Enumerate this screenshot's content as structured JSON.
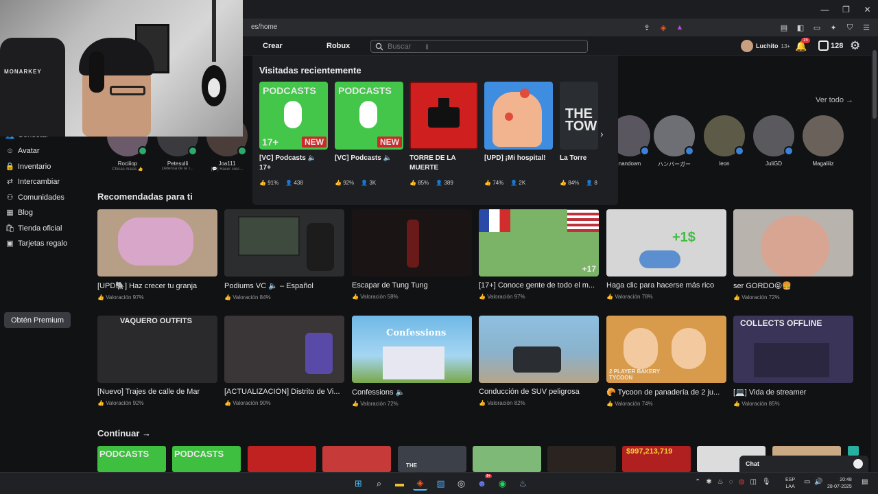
{
  "browser": {
    "url": "es/home",
    "window_minimize": "—",
    "window_restore": "❐",
    "window_close": "✕"
  },
  "nav": {
    "create": "Crear",
    "robux": "Robux",
    "search_placeholder": "Buscar",
    "username": "Luchito",
    "age_badge": "13+",
    "notif_count": "15",
    "robux_balance": "128"
  },
  "sidebar": {
    "items": [
      {
        "label": "Conectar",
        "icon": "people-icon"
      },
      {
        "label": "Avatar",
        "icon": "avatar-icon"
      },
      {
        "label": "Inventario",
        "icon": "lock-icon"
      },
      {
        "label": "Intercambiar",
        "icon": "trade-icon"
      },
      {
        "label": "Comunidades",
        "icon": "community-icon"
      },
      {
        "label": "Blog",
        "icon": "blog-icon"
      },
      {
        "label": "Tienda oficial",
        "icon": "shop-icon"
      },
      {
        "label": "Tarjetas regalo",
        "icon": "gift-icon"
      }
    ],
    "premium": "Obtén Premium"
  },
  "friends": {
    "view_all": "Ver todo →",
    "items": [
      {
        "name": "Rociiiop",
        "sub": "Chicas malas 👍"
      },
      {
        "name": "Petesulli",
        "sub": "Defensa de la T..."
      },
      {
        "name": "Joa111",
        "sub": "[💬] Hacer crec..."
      },
      {
        "name": "nandown",
        "sub": ""
      },
      {
        "name": "ハンバーガー",
        "sub": ""
      },
      {
        "name": "leon",
        "sub": ""
      },
      {
        "name": "JuliGD",
        "sub": ""
      },
      {
        "name": "Magaliiiz",
        "sub": ""
      }
    ]
  },
  "recently_visited": {
    "title": "Visitadas recientemente",
    "games": [
      {
        "title": "[VC] Podcasts 🔈 17+",
        "rating": "91%",
        "players": "438",
        "thumb_label": "PODCASTS",
        "badge": "NEW",
        "age": "17+"
      },
      {
        "title": "[VC] Podcasts 🔈",
        "rating": "92%",
        "players": "3K",
        "thumb_label": "PODCASTS",
        "badge": "NEW",
        "age": ""
      },
      {
        "title": "TORRE DE LA MUERTE",
        "rating": "85%",
        "players": "389",
        "thumb_label": "",
        "badge": "",
        "age": ""
      },
      {
        "title": "[UPD] ¡Mi hospital!",
        "rating": "74%",
        "players": "2K",
        "thumb_label": "",
        "badge": "",
        "age": ""
      },
      {
        "title": "La Torre",
        "rating": "84%",
        "players": "8",
        "thumb_label": "THE TOW",
        "badge": "",
        "age": ""
      }
    ]
  },
  "recommended": {
    "title": "Recomendadas para ti",
    "row1": [
      {
        "title": "[UPD🐘] Haz crecer tu granja",
        "rating": "Valoración 97%"
      },
      {
        "title": "Podiums VC 🔈 – Español",
        "rating": "Valoración 84%"
      },
      {
        "title": "Escapar de Tung Tung",
        "rating": "Valoración 58%"
      },
      {
        "title": "[17+] Conoce gente de todo el m...",
        "rating": "Valoración 97%",
        "overlay": "+17"
      },
      {
        "title": "Haga clic para hacerse más rico",
        "rating": "Valoración 78%",
        "overlay": "+1$"
      },
      {
        "title": "ser GORDO😝🍔",
        "rating": "Valoración 72%"
      }
    ],
    "row2": [
      {
        "title": "[Nuevo] Trajes de calle de Mar",
        "rating": "Valoración 92%",
        "overlay": "VAQUERO OUTFITS"
      },
      {
        "title": "[ACTUALIZACIÓN] Distrito de Vi...",
        "rating": "Valoración 90%"
      },
      {
        "title": "Confessions 🔈",
        "rating": "Valoración 72%",
        "overlay": "Confessions"
      },
      {
        "title": "Conducción de SUV peligrosa",
        "rating": "Valoración 82%"
      },
      {
        "title": "🥐 Tycoon de panadería de 2 ju...",
        "rating": "Valoración 74%",
        "overlay": "2 PLAYER BAKERY TYCOON"
      },
      {
        "title": "[💻] Vida de streamer",
        "rating": "Valoración 85%",
        "overlay": "COLLECTS OFFLINE"
      }
    ]
  },
  "continue": {
    "title": "Continuar →",
    "thumbs": [
      "PODCASTS",
      "PODCASTS",
      "",
      "",
      "THE",
      "",
      "",
      "$997,213,719",
      "",
      ""
    ]
  },
  "chat": {
    "label": "Chat"
  },
  "taskbar": {
    "lang_top": "ESP",
    "lang_bottom": "LAA",
    "time": "20:48",
    "date": "28-07-2025",
    "discord_badge": "9+"
  },
  "colors": {
    "bg": "#111214",
    "panel": "#1e1f23",
    "accent_green": "#2fa86b",
    "accent_blue": "#3b82d6",
    "podcast_green": "#3fbf3f",
    "red": "#d62b2b"
  }
}
